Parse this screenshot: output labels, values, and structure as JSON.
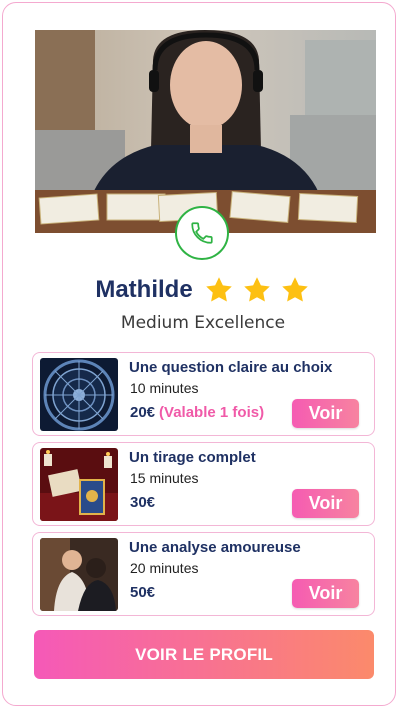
{
  "advisor": {
    "name": "Mathilde",
    "rating": 3,
    "subtitle": "Medium Excellence"
  },
  "offers": [
    {
      "title": "Une question claire au choix",
      "duration": "10 minutes",
      "price": "20€",
      "note": "(Valable 1 fois)",
      "button": "Voir"
    },
    {
      "title": "Un tirage complet",
      "duration": "15 minutes",
      "price": "30€",
      "note": "",
      "button": "Voir"
    },
    {
      "title": "Une analyse amoureuse",
      "duration": "20 minutes",
      "price": "50€",
      "note": "",
      "button": "Voir"
    }
  ],
  "profile_button": "VOIR LE PROFIL",
  "colors": {
    "accent_pink": "#f55bb2",
    "navy": "#1f3163",
    "star": "#fdc012",
    "call_green": "#2fb344"
  },
  "icons": [
    "phone-icon",
    "star-icon"
  ]
}
